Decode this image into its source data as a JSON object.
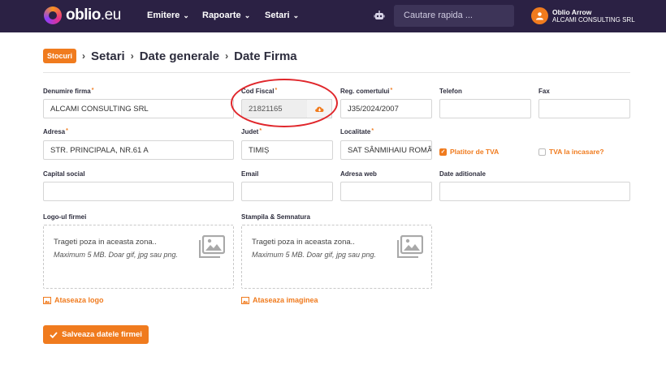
{
  "app": {
    "logo_main": "oblio",
    "logo_suffix": ".eu"
  },
  "nav": [
    {
      "label": "Emitere"
    },
    {
      "label": "Rapoarte"
    },
    {
      "label": "Setari"
    }
  ],
  "search": {
    "placeholder": "Cautare rapida ..."
  },
  "user": {
    "name": "Oblio Arrow",
    "company": "ALCAMI CONSULTING SRL"
  },
  "breadcrumb": {
    "pill": "Stocuri",
    "items": [
      "Setari",
      "Date generale",
      "Date Firma"
    ]
  },
  "form": {
    "denumire": {
      "label": "Denumire firma",
      "value": "ALCAMI CONSULTING SRL",
      "required": "*"
    },
    "cod_fiscal": {
      "label": "Cod Fiscal",
      "value": "21821165",
      "required": "*"
    },
    "reg_com": {
      "label": "Reg. comertului",
      "value": "J35/2024/2007",
      "required": "*"
    },
    "telefon": {
      "label": "Telefon",
      "value": ""
    },
    "fax": {
      "label": "Fax",
      "value": ""
    },
    "adresa": {
      "label": "Adresa",
      "value": "STR. PRINCIPALA,  NR.61 A",
      "required": "*"
    },
    "judet": {
      "label": "Judet",
      "value": "TIMIȘ",
      "required": "*"
    },
    "localitate": {
      "label": "Localitate",
      "value": "SAT SÂNMIHAIU ROMÂN",
      "required": "*"
    },
    "platitor_tva": {
      "label": "Platitor de TVA",
      "checked": true
    },
    "tva_incasare": {
      "label": "TVA la incasare?",
      "checked": false
    },
    "capital": {
      "label": "Capital social",
      "value": ""
    },
    "email": {
      "label": "Email",
      "value": ""
    },
    "web": {
      "label": "Adresa web",
      "value": ""
    },
    "date_aditionale": {
      "label": "Date aditionale",
      "value": ""
    },
    "logo": {
      "label": "Logo-ul firmei",
      "drop_text": "Trageti poza in aceasta zona..",
      "hint": "Maximum 5 MB. Doar gif, jpg sau png.",
      "attach": "Ataseaza logo"
    },
    "stampila": {
      "label": "Stampila & Semnatura",
      "drop_text": "Trageti poza in aceasta zona..",
      "hint": "Maximum 5 MB. Doar gif, jpg sau png.",
      "attach": "Ataseaza imaginea"
    },
    "save_label": "Salveaza datele firmei"
  },
  "colors": {
    "accent": "#f07b1e",
    "topbar": "#2b2144",
    "highlight_ring": "#e0262b"
  }
}
